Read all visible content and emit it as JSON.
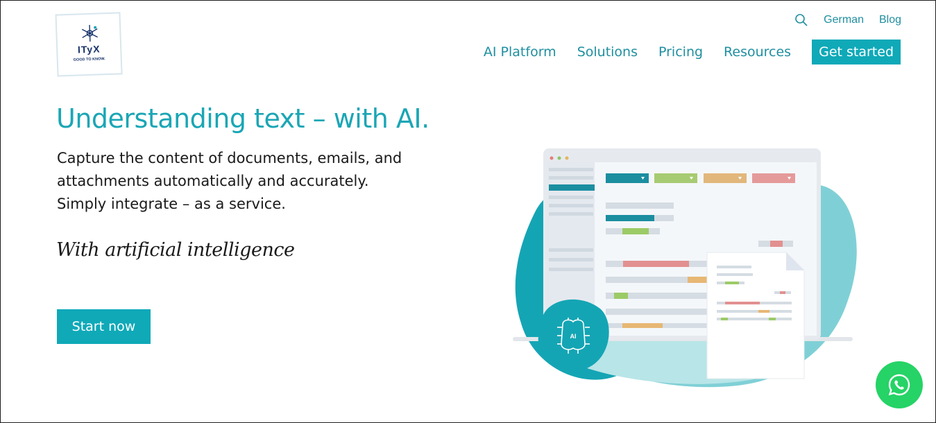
{
  "logo": {
    "brand": "ITyX",
    "tagline": "GOOD TO KNOW."
  },
  "topnav": {
    "german": "German",
    "blog": "Blog"
  },
  "mainnav": {
    "items": [
      "AI Platform",
      "Solutions",
      "Pricing",
      "Resources"
    ],
    "cta": "Get started"
  },
  "hero": {
    "title": "Understanding text – with AI.",
    "lead_lines": [
      "Capture the content of documents, emails, and",
      "attachments automatically and accurately.",
      "Simply integrate – as a service."
    ],
    "script": "With artificial intelligence",
    "button": "Start now"
  },
  "illustration": {
    "badge": "AI"
  },
  "colors": {
    "accent": "#0fa9b8",
    "text": "#1a1a1a",
    "whatsapp": "#25d366"
  },
  "icons": {
    "search": "search-icon",
    "whatsapp": "whatsapp-icon"
  }
}
